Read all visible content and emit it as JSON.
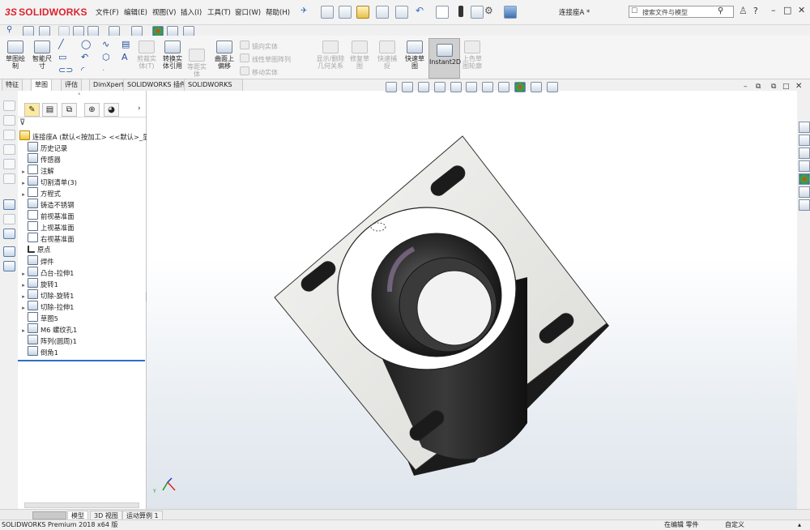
{
  "app": {
    "brand": "SOLIDWORKS",
    "brand_mark": "3S",
    "document_title": "连接座A *"
  },
  "menu": [
    "文件(F)",
    "编辑(E)",
    "视图(V)",
    "插入(I)",
    "工具(T)",
    "窗口(W)",
    "帮助(H)"
  ],
  "search": {
    "placeholder": "搜索文件与模型"
  },
  "help_label": "?",
  "command_manager": {
    "sketch": "草图绘\n制",
    "smart_dim": "智能尺\n寸",
    "trim": "剪裁实\n体(T)",
    "convert": "转换实\n体引用",
    "offset": "等距实\n体",
    "surface_offset": "曲面上\n偏移",
    "mirror": "镜向实体",
    "linear_pattern": "线性草图阵列",
    "move": "移动实体",
    "relations": "显示/删除\n几何关系",
    "repair": "修复草\n图",
    "quick_snaps": "快速捕\n捉",
    "rapid_sketch": "快速草\n图",
    "instant2d": "Instant2D",
    "shaded_sketch": "上色草\n图轮廓"
  },
  "tabs": [
    "特征",
    "草图",
    "评估",
    "DimXpert",
    "SOLIDWORKS 插件",
    "SOLIDWORKS MBD"
  ],
  "tree": {
    "root": "连接座A  (默认<按加工> <<默认>_显示状",
    "items": [
      {
        "label": "历史记录",
        "arrow": ""
      },
      {
        "label": "传感器",
        "arrow": ""
      },
      {
        "label": "注解",
        "arrow": "▸"
      },
      {
        "label": "切割清单(3)",
        "arrow": "▸"
      },
      {
        "label": "方程式",
        "arrow": "▸"
      },
      {
        "label": "铸造不锈钢",
        "arrow": ""
      },
      {
        "label": "前视基准面",
        "arrow": ""
      },
      {
        "label": "上视基准面",
        "arrow": ""
      },
      {
        "label": "右视基准面",
        "arrow": ""
      },
      {
        "label": "原点",
        "arrow": ""
      },
      {
        "label": "焊件",
        "arrow": ""
      },
      {
        "label": "凸台-拉伸1",
        "arrow": "▸"
      },
      {
        "label": "旋转1",
        "arrow": "▸"
      },
      {
        "label": "切除-旋转1",
        "arrow": "▸"
      },
      {
        "label": "切除-拉伸1",
        "arrow": "▸"
      },
      {
        "label": "草图5",
        "arrow": ""
      },
      {
        "label": "M6 螺纹孔1",
        "arrow": "▸"
      },
      {
        "label": "阵列(圆周)1",
        "arrow": ""
      },
      {
        "label": "倒角1",
        "arrow": ""
      }
    ]
  },
  "bottom_tabs": [
    "模型",
    "3D 视图",
    "运动算例 1"
  ],
  "status": {
    "product": "SOLIDWORKS Premium 2018 x64 版",
    "mode": "在编辑 零件",
    "units": "自定义"
  }
}
